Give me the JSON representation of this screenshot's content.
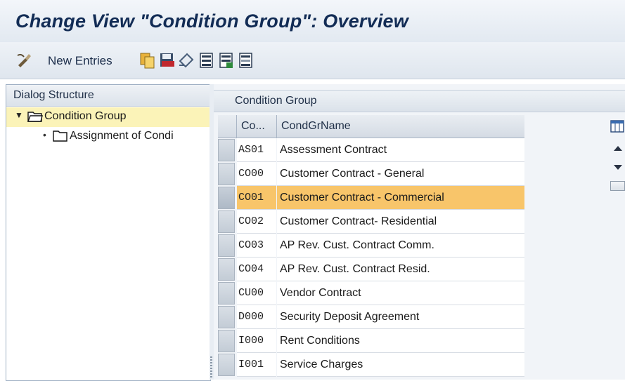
{
  "window": {
    "title": "Change View \"Condition Group\": Overview"
  },
  "toolbar": {
    "new_entries_label": "New Entries",
    "icons": [
      "change-display-icon",
      "copy-icon",
      "save-as-icon",
      "undo-icon",
      "select-all-icon",
      "select-block-icon",
      "deselect-all-icon"
    ]
  },
  "dialog_structure": {
    "header": "Dialog Structure",
    "items": [
      {
        "label": "Condition Group",
        "level": 0,
        "expanded": true,
        "selected": true
      },
      {
        "label": "Assignment of Condi",
        "level": 1,
        "expanded": false,
        "selected": false
      }
    ]
  },
  "condition_group": {
    "header": "Condition Group",
    "columns": {
      "code": "Co...",
      "name": "CondGrName"
    },
    "rows": [
      {
        "code": "AS01",
        "name": "Assessment Contract",
        "selected": false
      },
      {
        "code": "CO00",
        "name": "Customer Contract - General",
        "selected": false
      },
      {
        "code": "CO01",
        "name": "Customer Contract - Commercial",
        "selected": true
      },
      {
        "code": "CO02",
        "name": "Customer Contract- Residential",
        "selected": false
      },
      {
        "code": "CO03",
        "name": "AP Rev. Cust. Contract Comm.",
        "selected": false
      },
      {
        "code": "CO04",
        "name": "AP Rev. Cust. Contract Resid.",
        "selected": false
      },
      {
        "code": "CU00",
        "name": "Vendor Contract",
        "selected": false
      },
      {
        "code": "D000",
        "name": "Security Deposit Agreement",
        "selected": false
      },
      {
        "code": "I000",
        "name": "Rent Conditions",
        "selected": false
      },
      {
        "code": "I001",
        "name": "Service Charges",
        "selected": false
      }
    ]
  },
  "colors": {
    "selected_row": "#f8c56a",
    "selected_tree_item": "#fbf3b8",
    "title_text": "#122c55"
  }
}
